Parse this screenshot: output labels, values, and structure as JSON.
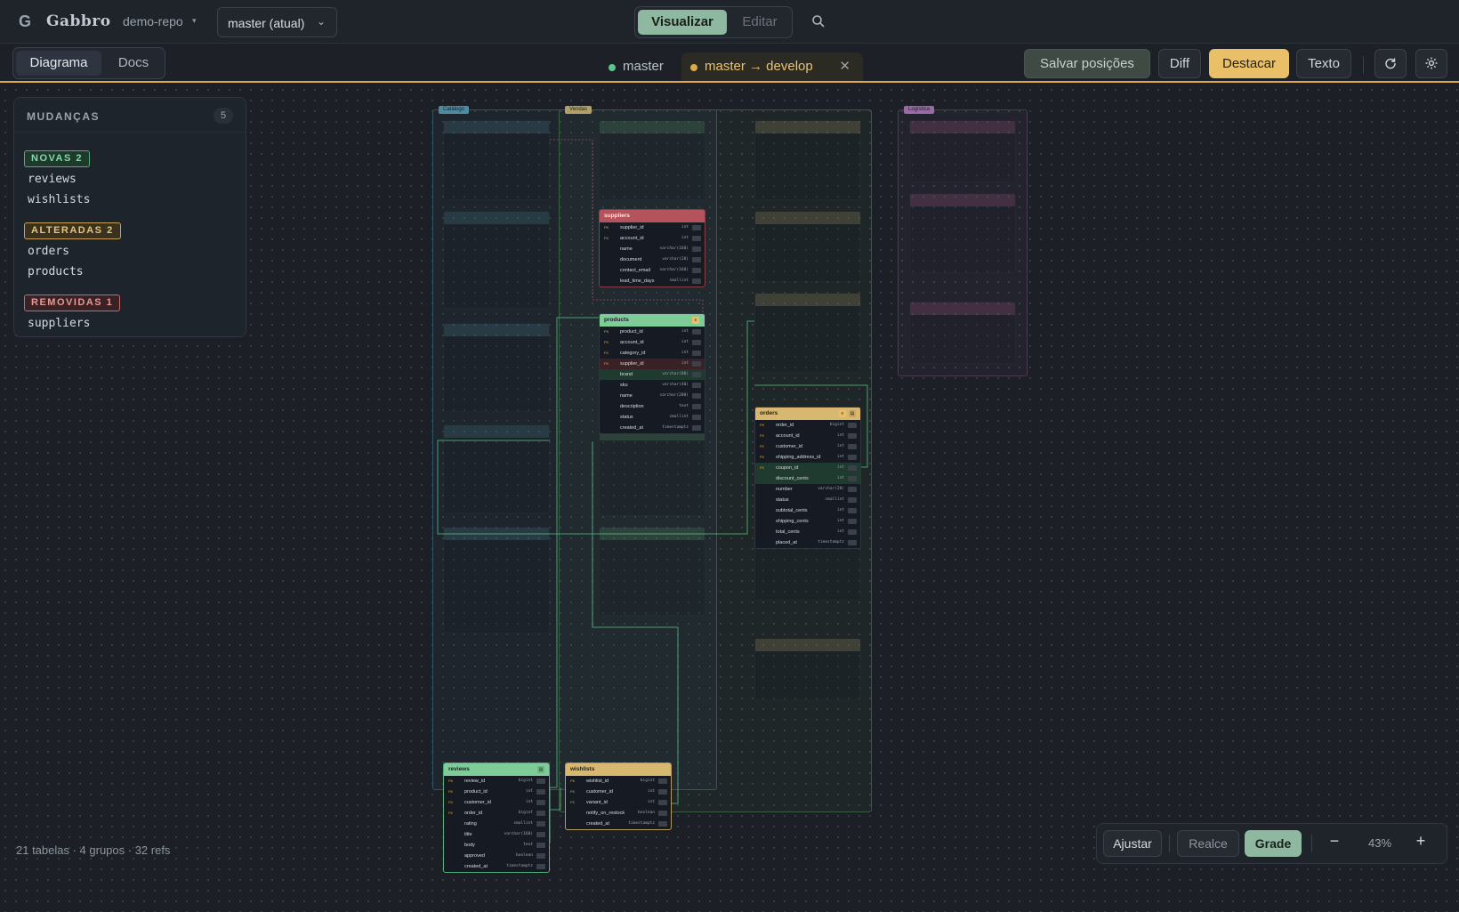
{
  "app": {
    "brand": "Gabbro",
    "repo": "demo-repo",
    "branch_selected": "master (atual)"
  },
  "mode": {
    "view_label": "Visualizar",
    "edit_label": "Editar"
  },
  "toolbar": {
    "tab_diagram": "Diagrama",
    "tab_docs": "Docs",
    "branch_tab_master": "master",
    "branch_tab_compare": "master → develop",
    "close_symbol": "✕",
    "save_positions": "Salvar posições",
    "diff": "Diff",
    "highlight": "Destacar",
    "text": "Texto"
  },
  "changes": {
    "title": "MUDANÇAS",
    "count": "5",
    "new_label": "NOVAS 2",
    "new_items": [
      "reviews",
      "wishlists"
    ],
    "modified_label": "ALTERADAS 2",
    "modified_items": [
      "orders",
      "products"
    ],
    "removed_label": "REMOVIDAS 1",
    "removed_items": [
      "suppliers"
    ]
  },
  "groups": {
    "g1": "Catálogo",
    "g2": "Vendas",
    "g3": "Logística"
  },
  "tables": {
    "suppliers": {
      "name": "suppliers",
      "rows": [
        {
          "pk": "PK",
          "name": "supplier_id",
          "type": "int"
        },
        {
          "pk": "FK",
          "name": "account_id",
          "type": "int"
        },
        {
          "pk": "",
          "name": "name",
          "type": "varchar(160)"
        },
        {
          "pk": "",
          "name": "document",
          "type": "varchar(20)"
        },
        {
          "pk": "",
          "name": "contact_email",
          "type": "varchar(160)"
        },
        {
          "pk": "",
          "name": "lead_time_days",
          "type": "smallint"
        }
      ]
    },
    "products": {
      "name": "products",
      "rows": [
        {
          "pk": "PK",
          "name": "product_id",
          "type": "int"
        },
        {
          "pk": "FK",
          "name": "account_id",
          "type": "int"
        },
        {
          "pk": "FK",
          "name": "category_id",
          "type": "int"
        },
        {
          "pk": "FK",
          "name": "supplier_id",
          "type": "int"
        },
        {
          "pk": "",
          "name": "brand",
          "type": "varchar(80)"
        },
        {
          "pk": "",
          "name": "sku",
          "type": "varchar(40)"
        },
        {
          "pk": "",
          "name": "name",
          "type": "varchar(200)"
        },
        {
          "pk": "",
          "name": "description",
          "type": "text"
        },
        {
          "pk": "",
          "name": "status",
          "type": "smallint"
        },
        {
          "pk": "",
          "name": "created_at",
          "type": "timestamptz"
        }
      ]
    },
    "orders": {
      "name": "orders",
      "rows": [
        {
          "pk": "PK",
          "name": "order_id",
          "type": "bigint"
        },
        {
          "pk": "FK",
          "name": "account_id",
          "type": "int"
        },
        {
          "pk": "FK",
          "name": "customer_id",
          "type": "int"
        },
        {
          "pk": "FK",
          "name": "shipping_address_id",
          "type": "int"
        },
        {
          "pk": "FK",
          "name": "coupon_id",
          "type": "int"
        },
        {
          "pk": "",
          "name": "discount_cents",
          "type": "int"
        },
        {
          "pk": "",
          "name": "number",
          "type": "varchar(20)"
        },
        {
          "pk": "",
          "name": "status",
          "type": "smallint"
        },
        {
          "pk": "",
          "name": "subtotal_cents",
          "type": "int"
        },
        {
          "pk": "",
          "name": "shipping_cents",
          "type": "int"
        },
        {
          "pk": "",
          "name": "total_cents",
          "type": "int"
        },
        {
          "pk": "",
          "name": "placed_at",
          "type": "timestamptz"
        }
      ]
    },
    "reviews": {
      "name": "reviews",
      "rows": [
        {
          "pk": "PK",
          "name": "review_id",
          "type": "bigint"
        },
        {
          "pk": "FK",
          "name": "product_id",
          "type": "int"
        },
        {
          "pk": "FK",
          "name": "customer_id",
          "type": "int"
        },
        {
          "pk": "FK",
          "name": "order_id",
          "type": "bigint"
        },
        {
          "pk": "",
          "name": "rating",
          "type": "smallint"
        },
        {
          "pk": "",
          "name": "title",
          "type": "varchar(160)"
        },
        {
          "pk": "",
          "name": "body",
          "type": "text"
        },
        {
          "pk": "",
          "name": "approved",
          "type": "boolean"
        },
        {
          "pk": "",
          "name": "created_at",
          "type": "timestamptz"
        }
      ]
    },
    "wishlists": {
      "name": "wishlists",
      "rows": [
        {
          "pk": "PK",
          "name": "wishlist_id",
          "type": "bigint"
        },
        {
          "pk": "FK",
          "name": "customer_id",
          "type": "int"
        },
        {
          "pk": "FK",
          "name": "variant_id",
          "type": "int"
        },
        {
          "pk": "",
          "name": "notify_on_restock",
          "type": "boolean"
        },
        {
          "pk": "",
          "name": "created_at",
          "type": "timestamptz"
        }
      ]
    }
  },
  "status": "21 tabelas · 4 grupos · 32 refs",
  "zoombar": {
    "fit": "Ajustar",
    "realce": "Realce",
    "grid": "Grade",
    "minus": "−",
    "plus": "+",
    "zoom": "43%"
  },
  "colors": {
    "accent": "#d9a94c",
    "new_header": "#7ecc98",
    "modified_header": "#d8b770",
    "removed_header": "#b5535c",
    "primary_button": "#8fb8a0"
  }
}
